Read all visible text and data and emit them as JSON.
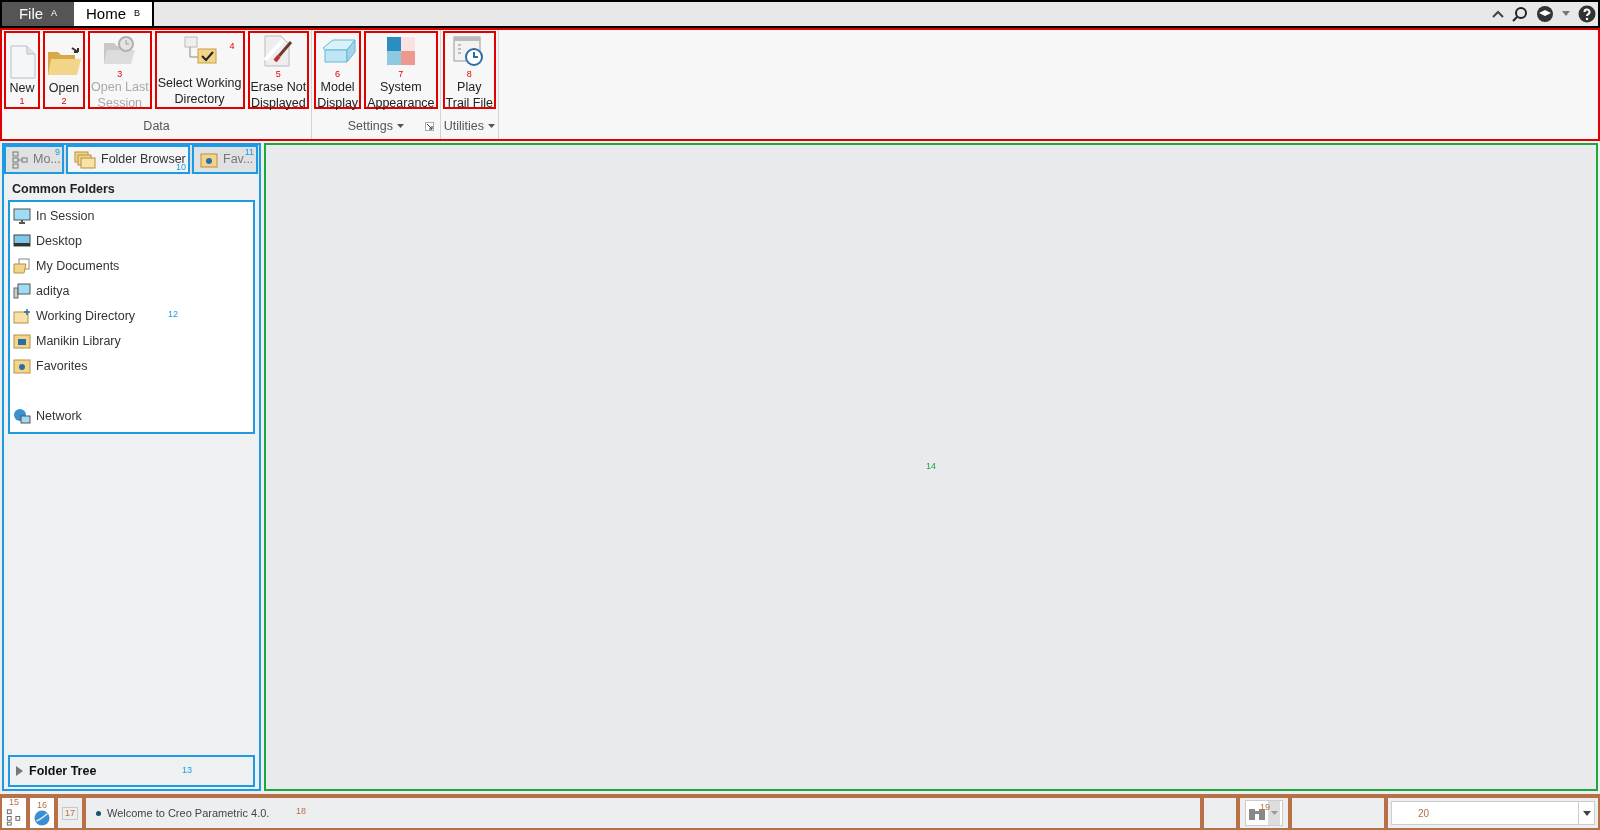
{
  "menu_tabs": [
    {
      "label": "File",
      "key_tip": "A",
      "kind": "file",
      "selected": false
    },
    {
      "label": "Home",
      "key_tip": "B",
      "kind": "tab",
      "selected": true
    }
  ],
  "ribbon": {
    "groups": [
      {
        "label": "Data",
        "dropdown": false,
        "launcher": false,
        "buttons": [
          {
            "label": "New",
            "marker": "1",
            "disabled": false
          },
          {
            "label": "Open",
            "marker": "2",
            "disabled": false
          },
          {
            "label": "Open Last\nSession",
            "marker": "3",
            "disabled": true
          },
          {
            "label": "Select Working\nDirectory",
            "marker": "4",
            "disabled": false
          },
          {
            "label": "Erase Not\nDisplayed",
            "marker": "5",
            "disabled": false
          }
        ]
      },
      {
        "label": "Settings",
        "dropdown": true,
        "launcher": true,
        "buttons": [
          {
            "label": "Model\nDisplay",
            "marker": "6",
            "disabled": false
          },
          {
            "label": "System\nAppearance",
            "marker": "7",
            "disabled": false
          }
        ]
      },
      {
        "label": "Utilities",
        "dropdown": true,
        "launcher": false,
        "buttons": [
          {
            "label": "Play\nTrail File",
            "marker": "8",
            "disabled": false
          }
        ]
      }
    ]
  },
  "navigator": {
    "tabs": [
      {
        "label": "Mo...",
        "marker": "9",
        "selected": false
      },
      {
        "label": "Folder Browser",
        "marker": "10",
        "selected": true
      },
      {
        "label": "Fav...",
        "marker": "11",
        "selected": false
      }
    ],
    "heading": "Common Folders",
    "folders": [
      {
        "label": "In Session"
      },
      {
        "label": "Desktop"
      },
      {
        "label": "My Documents"
      },
      {
        "label": "aditya"
      },
      {
        "label": "Working Directory"
      },
      {
        "label": "Manikin Library"
      },
      {
        "label": "Favorites"
      },
      {
        "label": "Network"
      }
    ],
    "folders_marker": "12",
    "folder_tree": {
      "label": "Folder Tree",
      "marker": "13",
      "expanded": false
    }
  },
  "graphics_area": {
    "marker": "14"
  },
  "status_bar": {
    "markers": [
      "15",
      "16",
      "17"
    ],
    "message": "Welcome to Creo Parametric 4.0.",
    "message_marker": "18",
    "find_marker": "19",
    "filter_marker": "20"
  }
}
